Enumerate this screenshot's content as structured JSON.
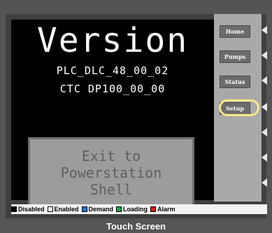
{
  "screen": {
    "title": "Version",
    "plc_version": "PLC_DLC_48_00_02",
    "ctc_version": "CTC DP100_00_00",
    "exit_button_label": "Exit to\nPowerstation\nShell"
  },
  "nav": {
    "home": "Home",
    "pumps": "Pumps",
    "status": "Status",
    "setup": "Setup"
  },
  "legend": {
    "items": [
      {
        "label": "Disabled",
        "color": "#000000"
      },
      {
        "label": "Enabled",
        "color": "#ffffff"
      },
      {
        "label": "Demand",
        "color": "#1e78d6"
      },
      {
        "label": "Loading",
        "color": "#1aa64a"
      },
      {
        "label": "Alarm",
        "color": "#e01a1a"
      }
    ]
  },
  "caption": "Touch Screen"
}
